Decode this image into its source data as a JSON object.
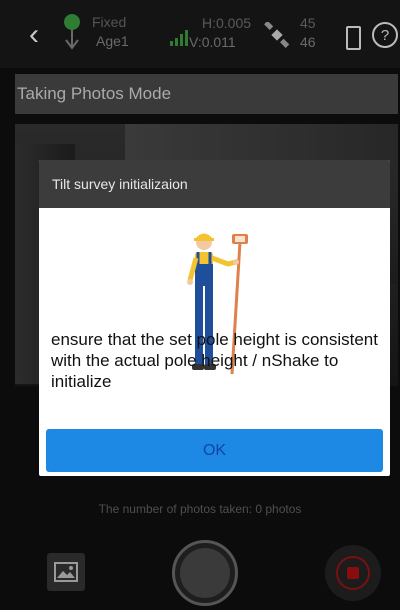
{
  "status": {
    "back_icon": "‹",
    "fix_status": "Fixed",
    "age": "Age1",
    "h_precision": "H:0.005",
    "v_precision": "V:0.011",
    "satellites_used": "45",
    "satellites_total": "46",
    "help_icon": "?"
  },
  "mode": {
    "title": "Taking Photos Mode"
  },
  "dialog": {
    "title": "Tilt survey initializaion",
    "message": "ensure that the set pole height is consistent with the actual pole height / nShake to initialize",
    "ok_label": "OK"
  },
  "footer": {
    "photo_count": "The number of photos taken: 0 photos"
  },
  "colors": {
    "accent": "#1e88e5",
    "fix_green": "#2e7d32",
    "record_red": "#8a0d0d"
  }
}
